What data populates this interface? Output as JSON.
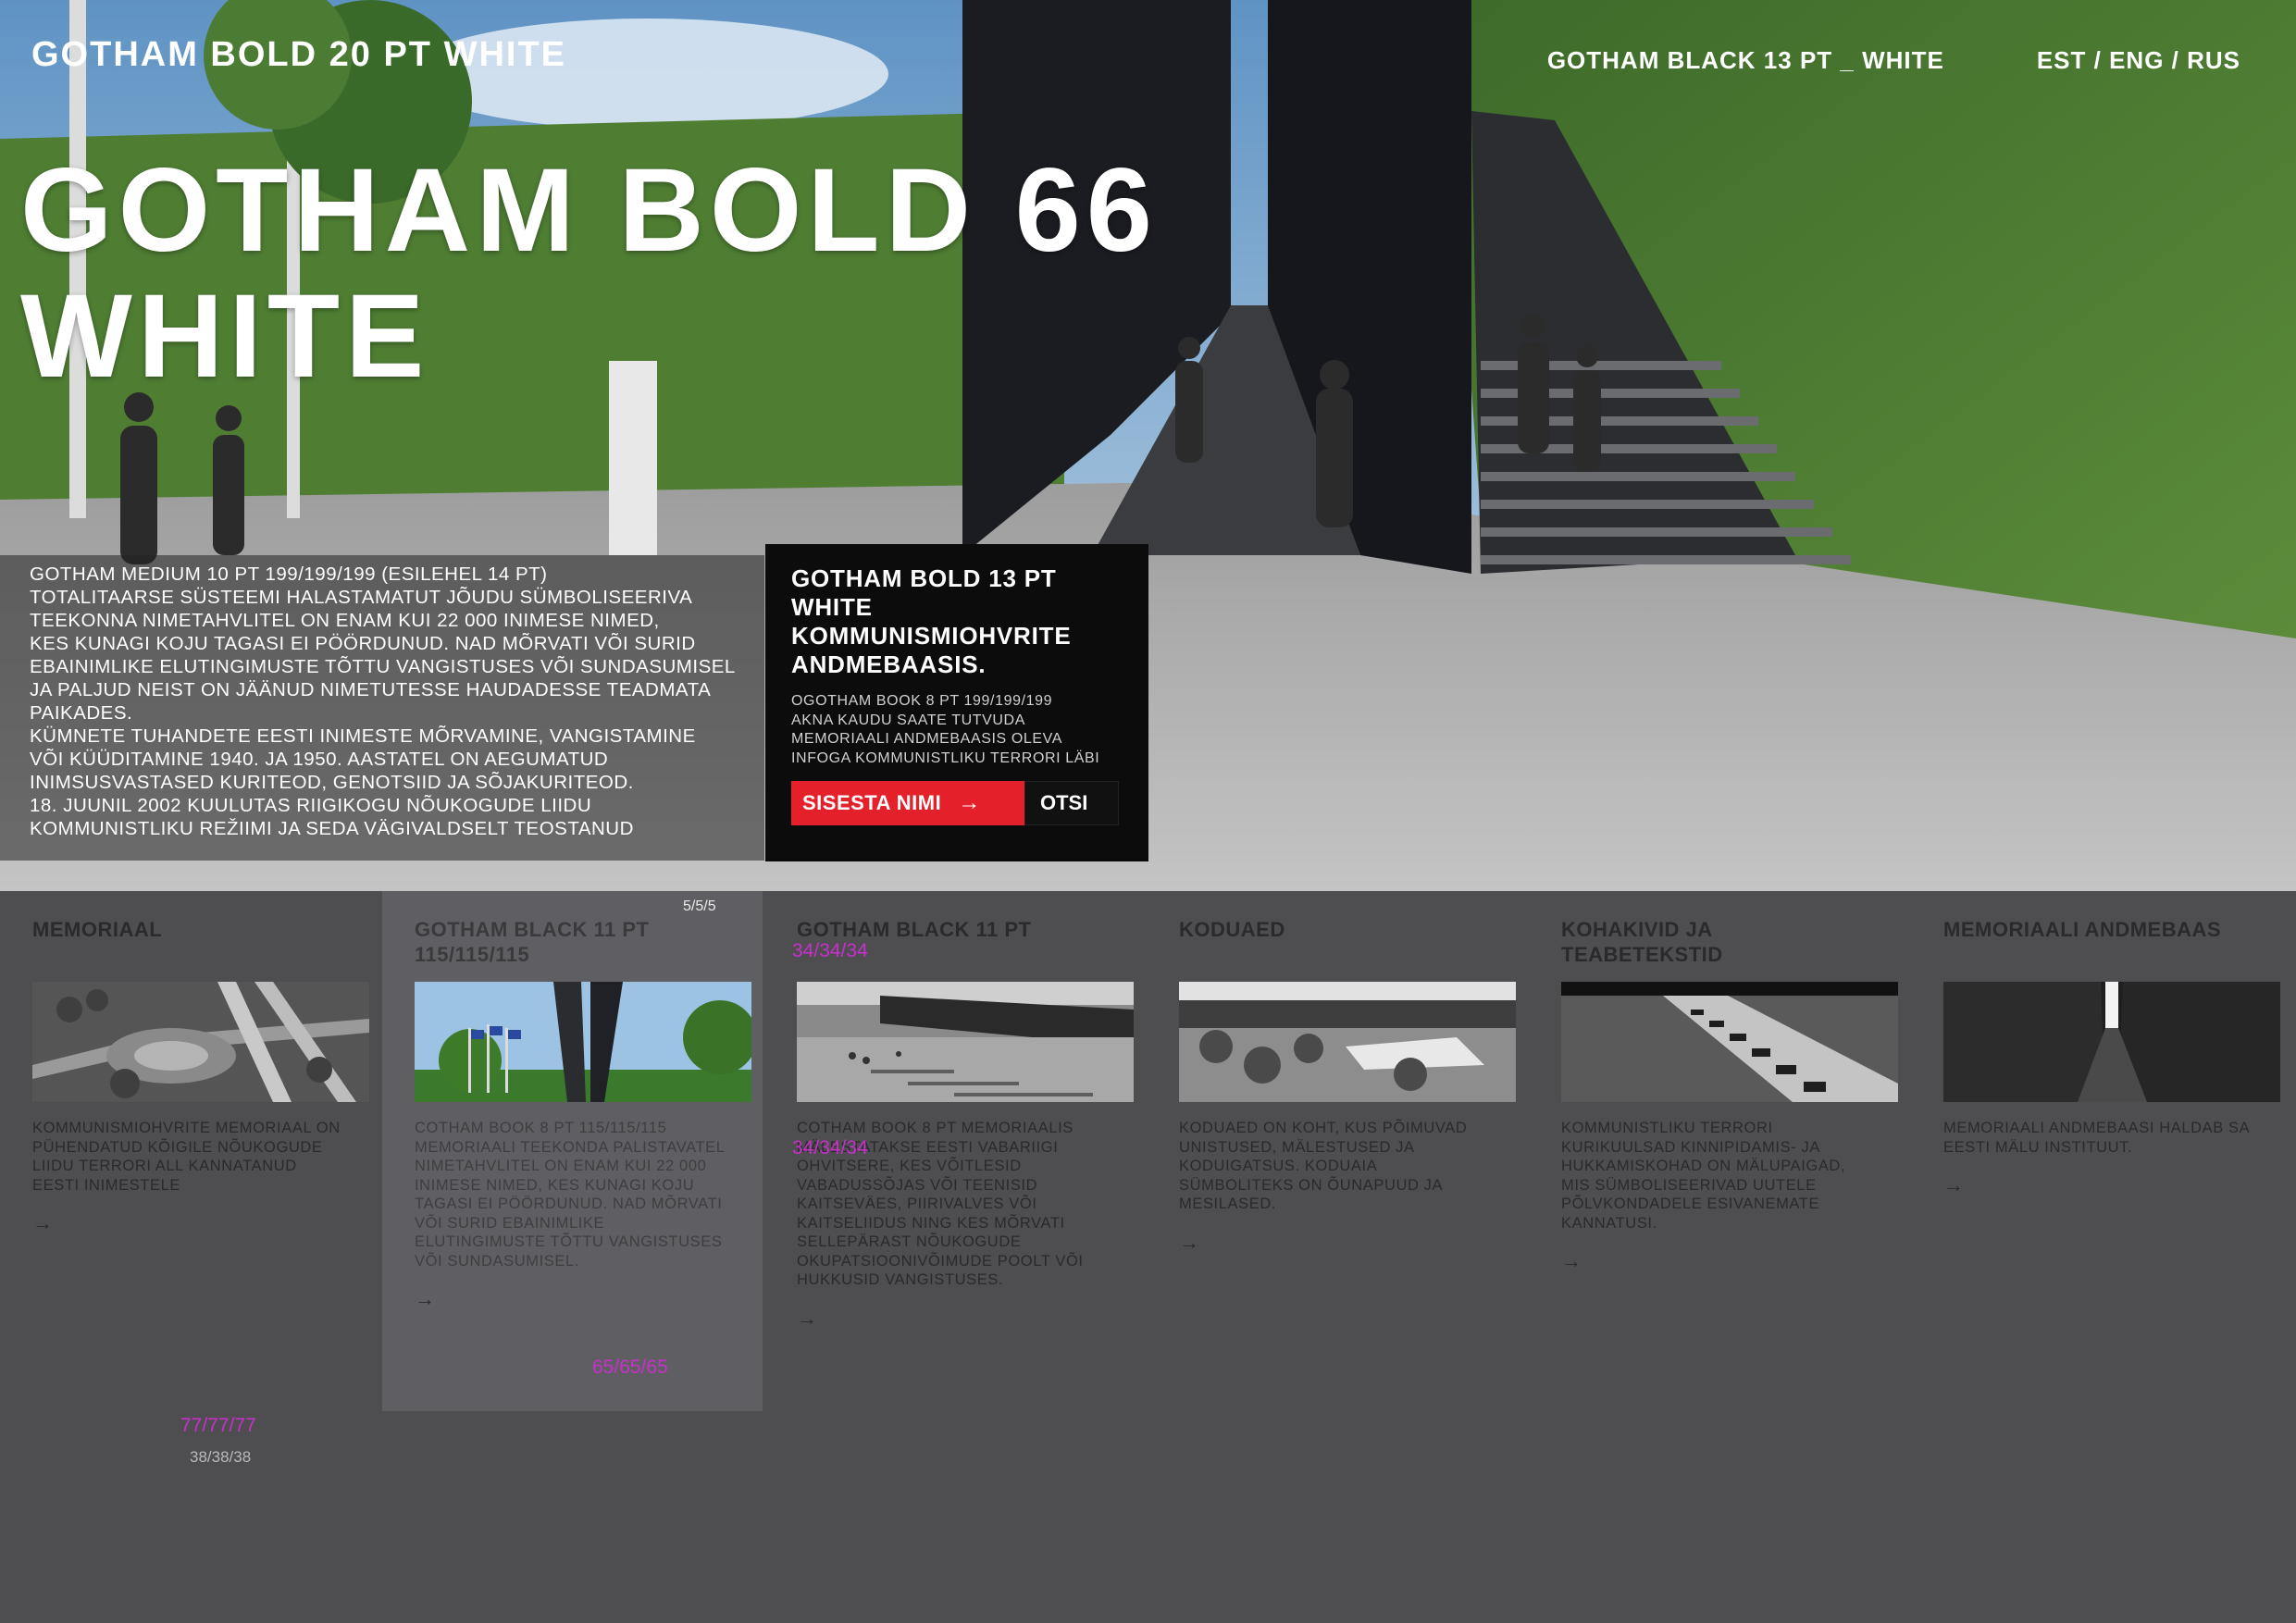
{
  "header": {
    "site_title": "GOTHAM BOLD 20 PT WHITE",
    "nav_link": "GOTHAM BLACK 13 PT _ WHITE",
    "languages": "EST / ENG / RUS"
  },
  "hero": {
    "headline_line1": "GOTHAM BOLD 66",
    "headline_line2": "WHITE"
  },
  "intro": {
    "lines": [
      "GOTHAM MEDIUM 10 PT    199/199/199  (ESILEHEL 14 PT)",
      "TOTALITAARSE SÜSTEEMI HALASTAMATUT JÕUDU SÜMBOLISEERIVA",
      "TEEKONNA NIMETAHVLITEL ON ENAM KUI 22 000 INIMESE NIMED,",
      "KES KUNAGI KOJU TAGASI EI PÖÖRDUNUD. NAD MÕRVATI VÕI SURID",
      "EBAINIMLIKE ELUTINGIMUSTE TÕTTU VANGISTUSES VÕI SUNDASUMISEL",
      "JA PALJUD NEIST ON JÄÄNUD NIMETUTESSE HAUDADESSE TEADMATA",
      "PAIKADES.",
      "KÜMNETE TUHANDETE EESTI INIMESTE MÕRVAMINE, VANGISTAMINE",
      "VÕI KÜÜDITAMINE 1940. JA 1950. AASTATEL ON AEGUMATUD",
      "INIMSUSVASTASED KURITEOD, GENOTSIID JA SÕJAKURITEOD.",
      "18. JUUNIL 2002 KUULUTAS RIIGIKOGU NÕUKOGUDE LIIDU",
      "KOMMUNISTLIKU REŽIIMI JA SEDA VÄGIVALDSELT TEOSTANUD"
    ]
  },
  "search_box": {
    "title_lines": [
      "GOTHAM BOLD 13 PT",
      "WHITE",
      "KOMMUNISMIOHVRITE",
      "ANDMEBAASIS."
    ],
    "desc_lines": [
      "OGOTHAM BOOK 8 PT   199/199/199",
      "AKNA KAUDU SAATE TUTVUDA",
      "MEMORIAALI ANDMEBAASIS OLEVA",
      "INFOGA KOMMUNISTLIKU TERRORI LÄBI"
    ],
    "input_label": "SISESTA NIMI",
    "input_arrow": "→",
    "search_label": "OTSI"
  },
  "cards": [
    {
      "title": "MEMORIAAL",
      "body": "KOMMUNISMIOHVRITE MEMORIAAL ON PÜHENDATUD KÕIGILE NÕUKOGUDE LIIDU TERRORI ALL KANNATANUD EESTI INIMESTELE",
      "arrow": "→",
      "thumb_icon": "aerial-photo-icon"
    },
    {
      "title": "GOTHAM BLACK 11 PT 115/115/115",
      "body": "COTHAM BOOK 8 PT 115/115/115 MEMORIAALI TEEKONDA PALISTAVATEL NIMETAHVLITEL ON ENAM KUI 22 000 INIMESE NIMED, KES KUNAGI KOJU TAGASI EI PÖÖRDUNUD. NAD MÕRVATI VÕI SURID EBAINIMLIKE ELUTINGIMUSTE TÕTTU VANGISTUSES VÕI SUNDASUMISEL.",
      "arrow": "→",
      "thumb_icon": "flags-photo-icon"
    },
    {
      "title": "GOTHAM BLACK 11 PT",
      "body": "COTHAM BOOK 8 PT MEMORIAALIS MÄLESTATAKSE EESTI VABARIIGI OHVITSERE, KES VÕITLESID VABADUSSÕJAS VÕI TEENISID KAITSEVÄES, PIIRIVALVES VÕI KAITSELIIDUS NING KES MÕRVATI SELLEPÄRAST NÕUKOGUDE OKUPATSIOONIVÕIMUDE POOLT VÕI HUKKUSID VANGISTUSES.",
      "arrow": "→",
      "thumb_icon": "plaza-photo-icon"
    },
    {
      "title": "KODUAED",
      "body": "KODUAED ON KOHT, KUS PÕIMUVAD UNISTUSED, MÄLESTUSED JA KODUIGATSUS. KODUAIA SÜMBOLITEKS ON ÕUNAPUUD JA MESILASED.",
      "arrow": "→",
      "thumb_icon": "garden-photo-icon"
    },
    {
      "title": "KOHAKIVID JA TEABETEKSTID",
      "body": "KOMMUNISTLIKU TERRORI KURIKUULSAD KINNIPIDAMIS- JA HUKKAMISKOHAD ON MÄLUPAIGAD, MIS SÜMBOLISEERIVAD UUTELE PÕLVKONDADELE ESIVANEMATE KANNATUSI.",
      "arrow": "→",
      "thumb_icon": "stones-photo-icon"
    },
    {
      "title": "MEMORIAALI ANDMEBAAS",
      "body": "MEMORIAALI ANDMEBAASI HALDAB SA EESTI MÄLU INSTITUUT.",
      "arrow": "→",
      "thumb_icon": "corridor-photo-icon"
    }
  ],
  "annotations": {
    "a_555": "5/5/5",
    "a_34_title": "34/34/34",
    "a_34_body": "34/34/34",
    "a_65": "65/65/65",
    "a_77": "77/77/77",
    "a_38": "38/38/38"
  },
  "colors": {
    "page_bg": "#4e4e51",
    "active_card_bg": "#5f5f63",
    "accent_red": "#e4202a",
    "annotation_magenta": "#c92fcb"
  }
}
